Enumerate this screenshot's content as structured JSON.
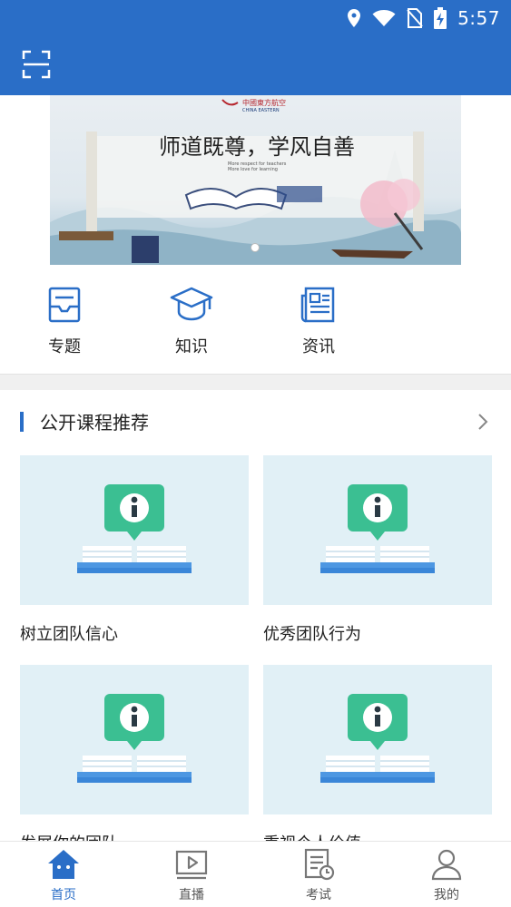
{
  "status_bar": {
    "time": "5:57"
  },
  "colors": {
    "primary": "#2a6ec7",
    "card_bg": "#e1f0f6",
    "icon_green": "#3bbf92"
  },
  "header": {
    "scan_icon": "scan-icon"
  },
  "banner": {
    "brand_cn": "中國東方航空",
    "brand_en": "CHINA EASTERN",
    "slogan": "师道既尊，学风自善",
    "sub1": "More respect for teachers",
    "sub2": "More love for learning",
    "page_indicator": "1 of 1"
  },
  "quick_nav": [
    {
      "label": "专题",
      "icon": "topic-icon"
    },
    {
      "label": "知识",
      "icon": "graduation-cap-icon"
    },
    {
      "label": "资讯",
      "icon": "news-icon"
    }
  ],
  "section": {
    "title": "公开课程推荐",
    "more_icon": "chevron-right-icon"
  },
  "courses": [
    {
      "title": "树立团队信心"
    },
    {
      "title": "优秀团队行为"
    },
    {
      "title": "发展你的团队"
    },
    {
      "title": "重视个人价值"
    }
  ],
  "tabbar": [
    {
      "label": "首页",
      "icon": "home-icon",
      "active": true
    },
    {
      "label": "直播",
      "icon": "live-icon",
      "active": false
    },
    {
      "label": "考试",
      "icon": "exam-icon",
      "active": false
    },
    {
      "label": "我的",
      "icon": "user-icon",
      "active": false
    }
  ]
}
